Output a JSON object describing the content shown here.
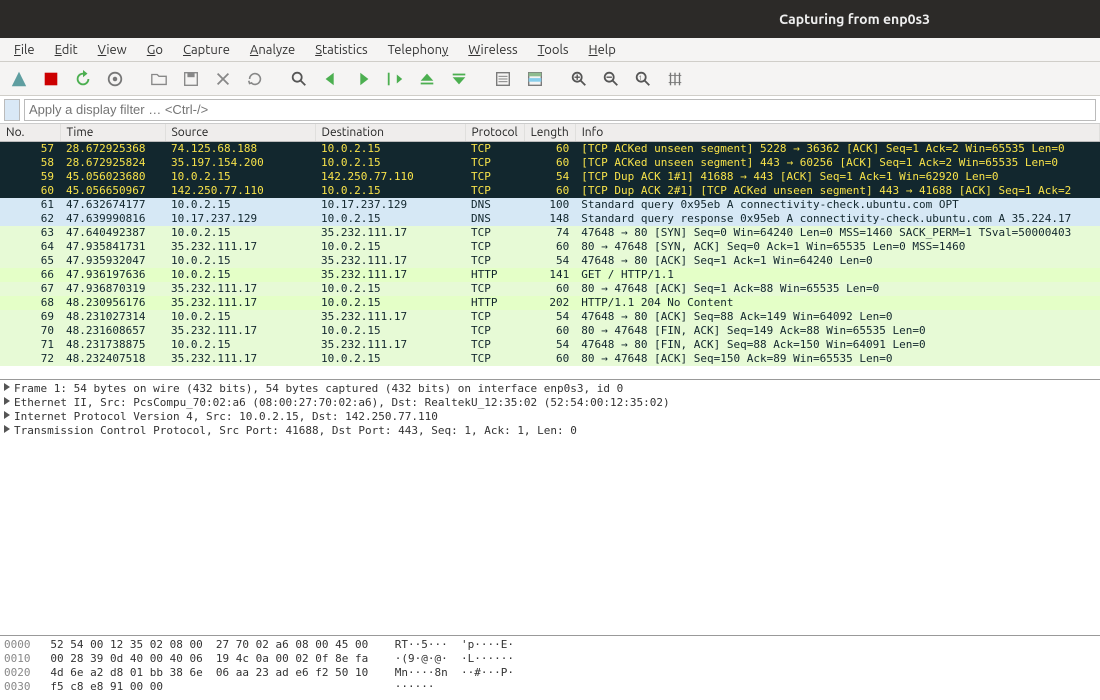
{
  "window": {
    "title": "Capturing from enp0s3"
  },
  "menu": {
    "items": [
      "File",
      "Edit",
      "View",
      "Go",
      "Capture",
      "Analyze",
      "Statistics",
      "Telephony",
      "Wireless",
      "Tools",
      "Help"
    ]
  },
  "toolbar": {
    "icons": [
      "fin-icon",
      "stop-icon",
      "restart-icon",
      "options-icon",
      "open-icon",
      "save-icon",
      "close-icon",
      "reload-icon",
      "find-icon",
      "back-icon",
      "forward-icon",
      "jump-icon",
      "first-icon",
      "last-icon",
      "autoscroll-icon",
      "colorize-icon",
      "zoom-in-icon",
      "zoom-out-icon",
      "zoom-reset-icon",
      "resize-cols-icon"
    ]
  },
  "filter": {
    "placeholder": "Apply a display filter … <Ctrl-/>"
  },
  "columns": {
    "no": "No.",
    "time": "Time",
    "src": "Source",
    "dst": "Destination",
    "proto": "Protocol",
    "len": "Length",
    "info": "Info"
  },
  "packets": [
    {
      "style": "dark",
      "no": "57",
      "time": "28.672925368",
      "src": "74.125.68.188",
      "dst": "10.0.2.15",
      "proto": "TCP",
      "len": "60",
      "info": "[TCP ACKed unseen segment] 5228 → 36362 [ACK] Seq=1 Ack=2 Win=65535 Len=0"
    },
    {
      "style": "dark",
      "no": "58",
      "time": "28.672925824",
      "src": "35.197.154.200",
      "dst": "10.0.2.15",
      "proto": "TCP",
      "len": "60",
      "info": "[TCP ACKed unseen segment] 443 → 60256 [ACK] Seq=1 Ack=2 Win=65535 Len=0"
    },
    {
      "style": "dark",
      "no": "59",
      "time": "45.056023680",
      "src": "10.0.2.15",
      "dst": "142.250.77.110",
      "proto": "TCP",
      "len": "54",
      "info": "[TCP Dup ACK 1#1] 41688 → 443 [ACK] Seq=1 Ack=1 Win=62920 Len=0"
    },
    {
      "style": "dark",
      "no": "60",
      "time": "45.056650967",
      "src": "142.250.77.110",
      "dst": "10.0.2.15",
      "proto": "TCP",
      "len": "60",
      "info": "[TCP Dup ACK 2#1] [TCP ACKed unseen segment] 443 → 41688 [ACK] Seq=1 Ack=2"
    },
    {
      "style": "dns",
      "no": "61",
      "time": "47.632674177",
      "src": "10.0.2.15",
      "dst": "10.17.237.129",
      "proto": "DNS",
      "len": "100",
      "info": "Standard query 0x95eb A connectivity-check.ubuntu.com OPT"
    },
    {
      "style": "dns",
      "no": "62",
      "time": "47.639990816",
      "src": "10.17.237.129",
      "dst": "10.0.2.15",
      "proto": "DNS",
      "len": "148",
      "info": "Standard query response 0x95eb A connectivity-check.ubuntu.com A 35.224.17"
    },
    {
      "style": "light",
      "no": "63",
      "time": "47.640492387",
      "src": "10.0.2.15",
      "dst": "35.232.111.17",
      "proto": "TCP",
      "len": "74",
      "info": "47648 → 80 [SYN] Seq=0 Win=64240 Len=0 MSS=1460 SACK_PERM=1 TSval=50000403"
    },
    {
      "style": "light",
      "no": "64",
      "time": "47.935841731",
      "src": "35.232.111.17",
      "dst": "10.0.2.15",
      "proto": "TCP",
      "len": "60",
      "info": "80 → 47648 [SYN, ACK] Seq=0 Ack=1 Win=65535 Len=0 MSS=1460"
    },
    {
      "style": "light",
      "no": "65",
      "time": "47.935932047",
      "src": "10.0.2.15",
      "dst": "35.232.111.17",
      "proto": "TCP",
      "len": "54",
      "info": "47648 → 80 [ACK] Seq=1 Ack=1 Win=64240 Len=0"
    },
    {
      "style": "http",
      "no": "66",
      "time": "47.936197636",
      "src": "10.0.2.15",
      "dst": "35.232.111.17",
      "proto": "HTTP",
      "len": "141",
      "info": "GET / HTTP/1.1"
    },
    {
      "style": "light",
      "no": "67",
      "time": "47.936870319",
      "src": "35.232.111.17",
      "dst": "10.0.2.15",
      "proto": "TCP",
      "len": "60",
      "info": "80 → 47648 [ACK] Seq=1 Ack=88 Win=65535 Len=0"
    },
    {
      "style": "http",
      "no": "68",
      "time": "48.230956176",
      "src": "35.232.111.17",
      "dst": "10.0.2.15",
      "proto": "HTTP",
      "len": "202",
      "info": "HTTP/1.1 204 No Content"
    },
    {
      "style": "light",
      "no": "69",
      "time": "48.231027314",
      "src": "10.0.2.15",
      "dst": "35.232.111.17",
      "proto": "TCP",
      "len": "54",
      "info": "47648 → 80 [ACK] Seq=88 Ack=149 Win=64092 Len=0"
    },
    {
      "style": "light",
      "no": "70",
      "time": "48.231608657",
      "src": "35.232.111.17",
      "dst": "10.0.2.15",
      "proto": "TCP",
      "len": "60",
      "info": "80 → 47648 [FIN, ACK] Seq=149 Ack=88 Win=65535 Len=0"
    },
    {
      "style": "light",
      "no": "71",
      "time": "48.231738875",
      "src": "10.0.2.15",
      "dst": "35.232.111.17",
      "proto": "TCP",
      "len": "54",
      "info": "47648 → 80 [FIN, ACK] Seq=88 Ack=150 Win=64091 Len=0"
    },
    {
      "style": "light",
      "no": "72",
      "time": "48.232407518",
      "src": "35.232.111.17",
      "dst": "10.0.2.15",
      "proto": "TCP",
      "len": "60",
      "info": "80 → 47648 [ACK] Seq=150 Ack=89 Win=65535 Len=0"
    }
  ],
  "details": {
    "lines": [
      "Frame 1: 54 bytes on wire (432 bits), 54 bytes captured (432 bits) on interface enp0s3, id 0",
      "Ethernet II, Src: PcsCompu_70:02:a6 (08:00:27:70:02:a6), Dst: RealtekU_12:35:02 (52:54:00:12:35:02)",
      "Internet Protocol Version 4, Src: 10.0.2.15, Dst: 142.250.77.110",
      "Transmission Control Protocol, Src Port: 41688, Dst Port: 443, Seq: 1, Ack: 1, Len: 0"
    ]
  },
  "hexdump": {
    "rows": [
      {
        "off": "0000",
        "hex": "52 54 00 12 35 02 08 00  27 70 02 a6 08 00 45 00",
        "ascii": "RT··5···  'p····E·"
      },
      {
        "off": "0010",
        "hex": "00 28 39 0d 40 00 40 06  19 4c 0a 00 02 0f 8e fa",
        "ascii": "·(9·@·@·  ·L······"
      },
      {
        "off": "0020",
        "hex": "4d 6e a2 d8 01 bb 38 6e  06 aa 23 ad e6 f2 50 10",
        "ascii": "Mn····8n  ··#···P·"
      },
      {
        "off": "0030",
        "hex": "f5 c8 e8 91 00 00",
        "ascii": "······"
      }
    ]
  }
}
